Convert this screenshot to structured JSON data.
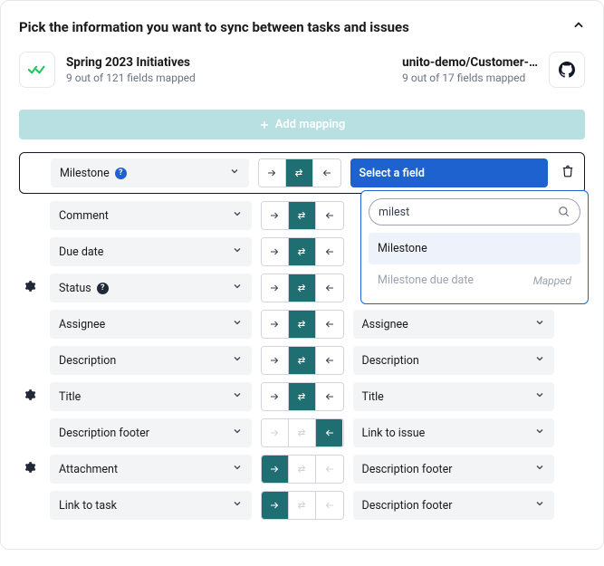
{
  "header": {
    "title": "Pick the information you want to sync between tasks and issues"
  },
  "tool_a": {
    "title": "Spring 2023 Initiatives",
    "sub": "9 out of 121 fields mapped"
  },
  "tool_b": {
    "title": "unito-demo/Customer-…",
    "sub": "9 out of 17 fields mapped"
  },
  "add_button": "Add mapping",
  "select_placeholder": "Select a field",
  "search_value": "milest",
  "dropdown": {
    "item1": "Milestone",
    "item2": "Milestone due date",
    "mapped_label": "Mapped"
  },
  "rows": [
    {
      "gear": false,
      "left": "Milestone",
      "left_q": "blue",
      "right": null,
      "dir": "both",
      "trash": true
    },
    {
      "gear": false,
      "left": "Comment",
      "left_q": null,
      "right": null,
      "dir": "both",
      "trash": false
    },
    {
      "gear": false,
      "left": "Due date",
      "left_q": null,
      "right": null,
      "dir": "both",
      "trash": false
    },
    {
      "gear": true,
      "left": "Status",
      "left_q": "dark",
      "right": null,
      "dir": "both",
      "trash": false
    },
    {
      "gear": false,
      "left": "Assignee",
      "left_q": null,
      "right": "Assignee",
      "dir": "both",
      "trash": false
    },
    {
      "gear": false,
      "left": "Description",
      "left_q": null,
      "right": "Description",
      "dir": "both",
      "trash": false
    },
    {
      "gear": true,
      "left": "Title",
      "left_q": null,
      "right": "Title",
      "dir": "both",
      "trash": false
    },
    {
      "gear": false,
      "left": "Description footer",
      "left_q": null,
      "right": "Link to issue",
      "dir": "left",
      "trash": false
    },
    {
      "gear": true,
      "left": "Attachment",
      "left_q": null,
      "right": "Description footer",
      "dir": "right",
      "trash": false
    },
    {
      "gear": false,
      "left": "Link to task",
      "left_q": null,
      "right": "Description footer",
      "dir": "right",
      "trash": false
    }
  ]
}
